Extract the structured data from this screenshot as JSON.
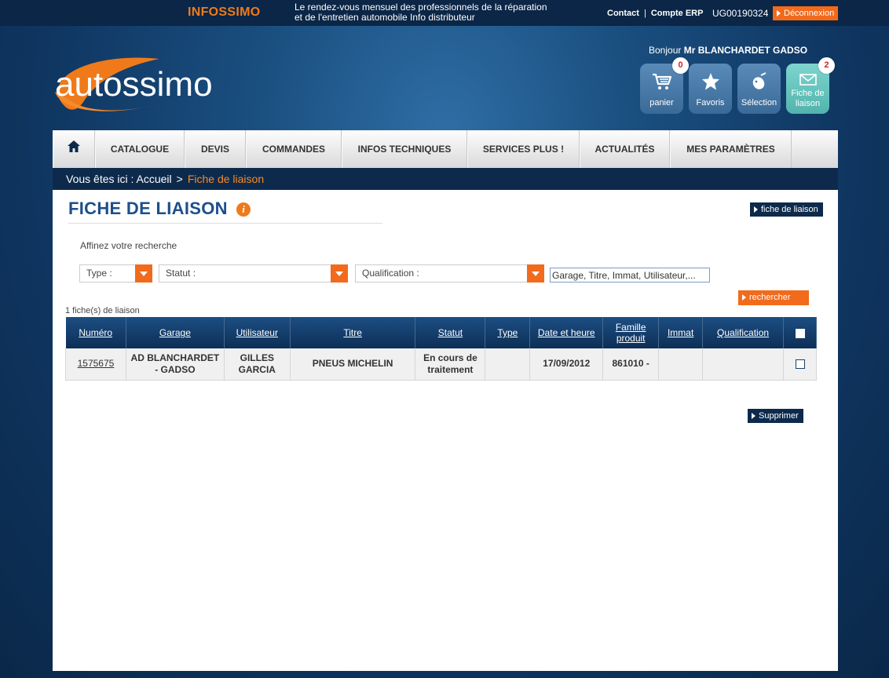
{
  "topbar": {
    "brand": "INFOSSIMO",
    "tagline_line1": "Le rendez-vous mensuel des professionnels de la réparation",
    "tagline_line2": "et de l'entretien automobile Info distributeur",
    "contact_label": "Contact",
    "separator": "|",
    "account_label": "Compte ERP",
    "account_code": "UG00190324",
    "logout_label": "Déconnexion"
  },
  "header": {
    "logo_text": "autossimo",
    "greeting_prefix": "Bonjour",
    "user_name": "Mr BLANCHARDET GADSO",
    "buttons": [
      {
        "label": "panier",
        "badge": "0",
        "icon": "cart-icon"
      },
      {
        "label": "Favoris",
        "icon": "star-icon"
      },
      {
        "label": "Sélection",
        "icon": "selection-icon"
      },
      {
        "label": "Fiche de liaison",
        "badge": "2",
        "icon": "envelope-icon"
      }
    ]
  },
  "nav": {
    "home_icon": "home-icon",
    "items": [
      "CATALOGUE",
      "DEVIS",
      "COMMANDES",
      "INFOS TECHNIQUES",
      "SERVICES PLUS !",
      "ACTUALITÉS",
      "MES PARAMÈTRES"
    ]
  },
  "breadcrumb": {
    "prefix": "Vous êtes ici : Accueil",
    "arrow": ">",
    "current": "Fiche de liaison"
  },
  "main": {
    "title": "FICHE DE LIAISON",
    "info_icon": "i",
    "top_button": "fiche de liaison",
    "refine_label": "Affinez votre recherche",
    "filters": {
      "type_label": "Type :",
      "statut_label": "Statut :",
      "qualification_label": "Qualification :",
      "search_value": "Garage, Titre, Immat, Utilisateur,..."
    },
    "search_button": "rechercher",
    "result_count": "1 fiche(s) de liaison",
    "table": {
      "headers": [
        "Numéro",
        "Garage",
        "Utilisateur",
        "Titre",
        "Statut",
        "Type",
        "Date et heure",
        "Famille produit",
        "Immat",
        "Qualification"
      ],
      "rows": [
        {
          "numero": "1575675",
          "garage": "AD BLANCHARDET - GADSO",
          "utilisateur": "GILLES GARCIA",
          "titre": "PNEUS MICHELIN",
          "statut": "En cours de traitement",
          "type": "",
          "date": "17/09/2012",
          "famille": "861010 -",
          "immat": "",
          "qualification": ""
        }
      ]
    },
    "delete_button": "Supprimer"
  },
  "colors": {
    "accent_orange": "#f26a1b",
    "navy": "#0d2a4c",
    "title_blue": "#1d4f8b"
  }
}
